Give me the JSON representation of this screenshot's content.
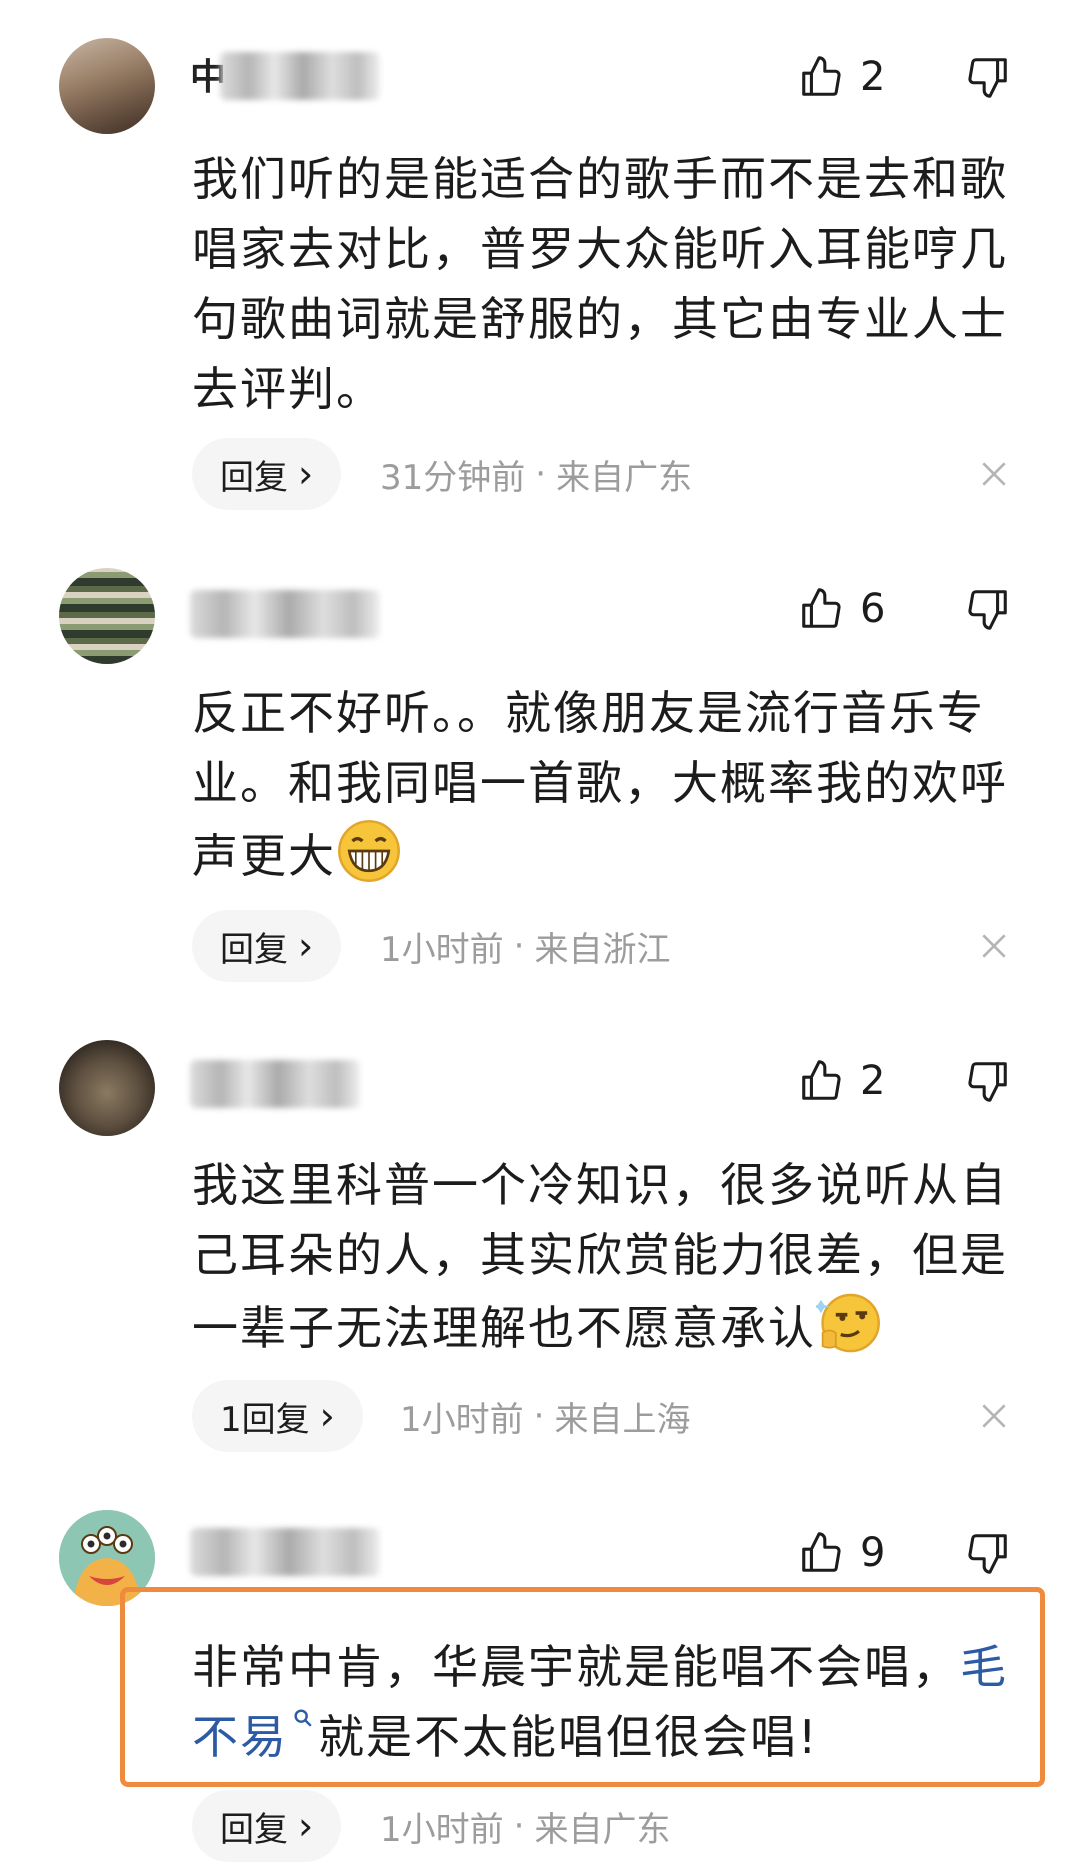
{
  "comments": [
    {
      "username_partial": "中",
      "likes": "2",
      "text": "我们听的是能适合的歌手而不是去和歌唱家去对比，普罗大众能听入耳能哼几句歌曲词就是舒服的，其它由专业人士去评判。",
      "reply_label": "回复",
      "time": "31分钟前",
      "location": "来自广东"
    },
    {
      "likes": "6",
      "text": "反正不好听。。就像朋友是流行音乐专业。和我同唱一首歌，大概率我的欢呼声更大",
      "reply_label": "回复",
      "time": "1小时前",
      "location": "来自浙江"
    },
    {
      "likes": "2",
      "text": "我这里科普一个冷知识，很多说听从自己耳朵的人，其实欣赏能力很差，但是一辈子无法理解也不愿意承认",
      "reply_label": "1回复",
      "time": "1小时前",
      "location": "来自上海"
    },
    {
      "likes": "9",
      "text_before_link": "非常中肯，华晨宇就是能唱不会唱，",
      "link_text": "毛不易",
      "text_after_link": "就是不太能唱但很会唱!",
      "reply_label": "回复",
      "time": "1小时前",
      "location": "来自广东"
    }
  ],
  "separator": "·",
  "reply_chevron": "›",
  "colors": {
    "link": "#2c5aa3",
    "meta_text": "#9c9c9c",
    "pill_bg": "#f5f5f5",
    "highlight_border": "#f08a3c"
  },
  "icons": [
    "thumbs-up-icon",
    "thumbs-down-icon",
    "close-icon",
    "search-icon",
    "grin-emoji",
    "smirk-emoji"
  ]
}
